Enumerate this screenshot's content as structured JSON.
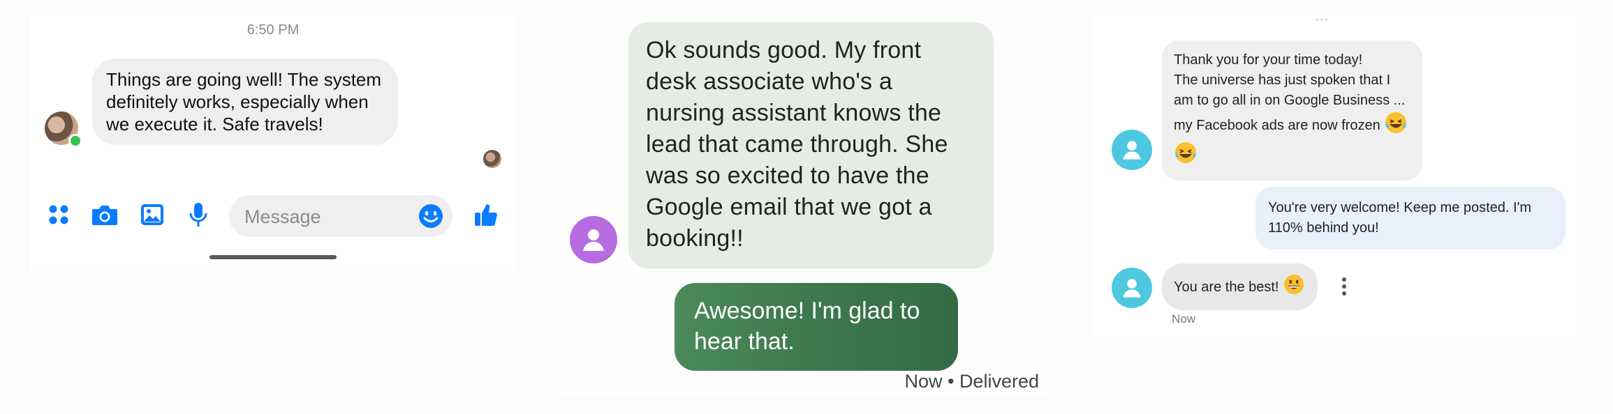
{
  "messenger": {
    "timestamp": "6:50 PM",
    "message": "Things are going well! The system definitely works, especially when we execute it. Safe travels!",
    "composer_placeholder": "Message",
    "icons": [
      "menu-grid-icon",
      "camera-icon",
      "gallery-icon",
      "microphone-icon",
      "emoji-icon",
      "thumbs-up-icon"
    ],
    "accent_color": "#0a7cff"
  },
  "chat_large": {
    "incoming": "Ok sounds good. My front desk associate who's a nursing assistant knows the lead that came through. She was so excited to have the Google email that we got a booking!!",
    "outgoing": "Awesome! I'm glad to hear that.",
    "status": "Now • Delivered",
    "avatar_color": "#b66be0",
    "outgoing_color": "#3f7a4f"
  },
  "chat_small": {
    "top_cut_text": "...",
    "incoming_1_lines": [
      "Thank you for your time today!",
      "The universe has just spoken that I",
      "am to go all in on Google Business ...",
      "my Facebook ads are now frozen"
    ],
    "incoming_1_emojis": [
      "laughing-tears-emoji",
      "laughing-tears-emoji"
    ],
    "outgoing_1": "You're very welcome!  Keep me posted.  I'm 110% behind you!",
    "incoming_2": "You are the best!",
    "incoming_2_emoji": "grinning-emoji",
    "timestamp": "Now",
    "avatar_color": "#4dc8e0"
  }
}
